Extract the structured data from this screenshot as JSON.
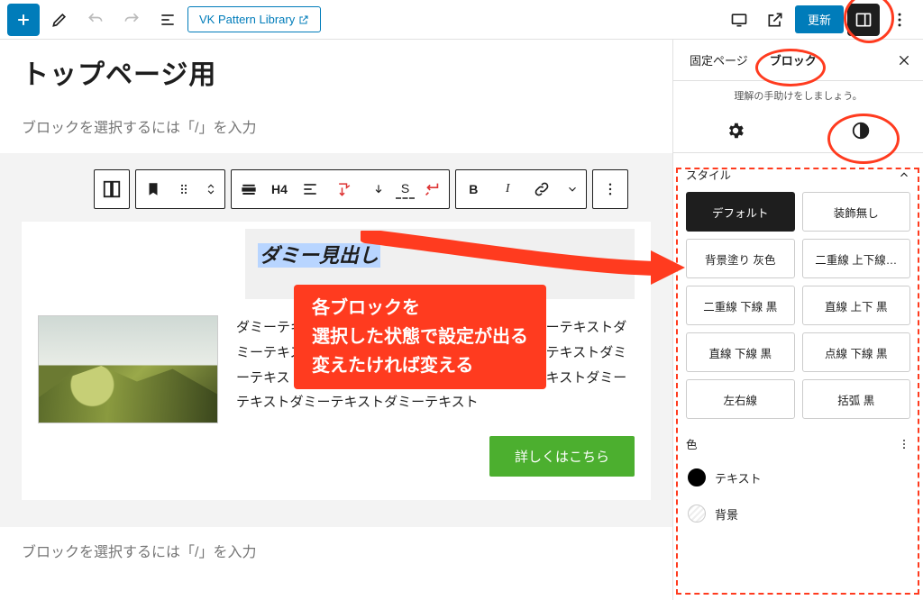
{
  "topbar": {
    "pattern_library_label": "VK Pattern Library",
    "update_label": "更新"
  },
  "editor": {
    "page_title": "トップページ用",
    "placeholder": "ブロックを選択するには「/」を入力",
    "heading_text": "ダミー見出し",
    "h_level": "H4",
    "toolbar_dash_s": "S",
    "body_text": "ダミーテキストダミーテキストダミーテキストダミーテキストダミーテキストダミーテキストダミーテキストダミーテキストダミーテキストダミーテキストダミーテキストダミーテキストダミーテキストダミーテキストダミーテキスト",
    "cta_label": "詳しくはこちら",
    "placeholder2": "ブロックを選択するには「/」を入力"
  },
  "annotation": {
    "line1": "各ブロックを",
    "line2": "選択した状態で設定が出る",
    "line3": "変えたければ変える"
  },
  "sidebar": {
    "tab_page": "固定ページ",
    "tab_block": "ブロック",
    "hint": "理解の手助けをしましょう。",
    "style_label": "スタイル",
    "styles": [
      "デフォルト",
      "装飾無し",
      "背景塗り 灰色",
      "二重線 上下線…",
      "二重線 下線 黒",
      "直線 上下 黒",
      "直線 下線 黒",
      "点線 下線 黒",
      "左右線",
      "括弧 黒"
    ],
    "color_label": "色",
    "color_text": "テキスト",
    "color_bg": "背景"
  }
}
